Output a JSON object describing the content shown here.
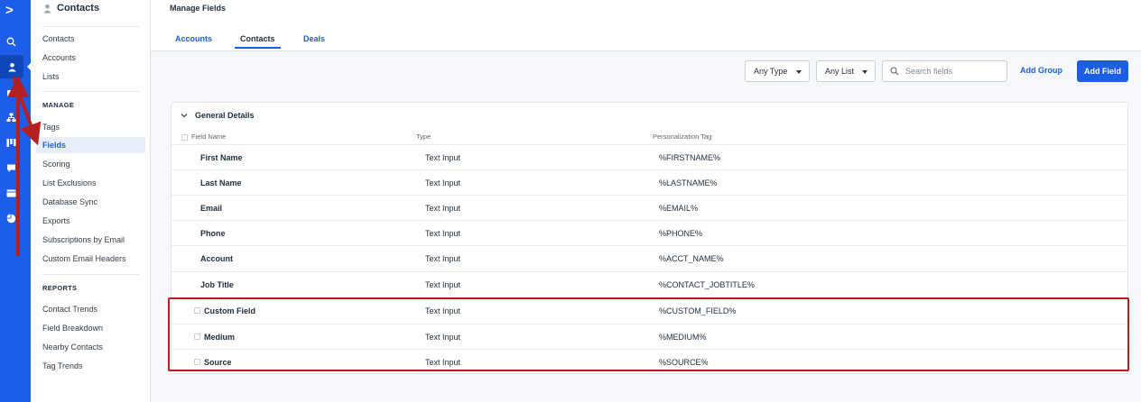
{
  "sidebar": {
    "title": "Contacts",
    "items": [
      {
        "label": "Contacts"
      },
      {
        "label": "Accounts"
      },
      {
        "label": "Lists"
      }
    ],
    "manage_heading": "MANAGE",
    "manage_items": [
      {
        "label": "Tags"
      },
      {
        "label": "Fields"
      },
      {
        "label": "Scoring"
      },
      {
        "label": "List Exclusions"
      },
      {
        "label": "Database Sync"
      },
      {
        "label": "Exports"
      },
      {
        "label": "Subscriptions by Email"
      },
      {
        "label": "Custom Email Headers"
      }
    ],
    "reports_heading": "REPORTS",
    "report_items": [
      {
        "label": "Contact Trends"
      },
      {
        "label": "Field Breakdown"
      },
      {
        "label": "Nearby Contacts"
      },
      {
        "label": "Tag Trends"
      }
    ]
  },
  "header": {
    "title": "Manage Fields",
    "tabs": [
      {
        "label": "Accounts"
      },
      {
        "label": "Contacts"
      },
      {
        "label": "Deals"
      }
    ]
  },
  "toolbar": {
    "type_filter": "Any Type",
    "list_filter": "Any List",
    "search_placeholder": "Search fields",
    "add_group": "Add Group",
    "add_field": "Add Field"
  },
  "table": {
    "group_name": "General Details",
    "columns": {
      "name": "Field Name",
      "type": "Type",
      "tag": "Personalization Tag"
    },
    "rows": [
      {
        "name": "First Name",
        "type": "Text Input",
        "tag": "%FIRSTNAME%"
      },
      {
        "name": "Last Name",
        "type": "Text Input",
        "tag": "%LASTNAME%"
      },
      {
        "name": "Email",
        "type": "Text Input",
        "tag": "%EMAIL%"
      },
      {
        "name": "Phone",
        "type": "Text Input",
        "tag": "%PHONE%"
      },
      {
        "name": "Account",
        "type": "Text Input",
        "tag": "%ACCT_NAME%"
      },
      {
        "name": "Job Title",
        "type": "Text Input",
        "tag": "%CONTACT_JOBTITLE%"
      },
      {
        "name": "Custom Field",
        "type": "Text Input",
        "tag": "%CUSTOM_FIELD%"
      },
      {
        "name": "Medium",
        "type": "Text Input",
        "tag": "%MEDIUM%"
      },
      {
        "name": "Source",
        "type": "Text Input",
        "tag": "%SOURCE%"
      }
    ]
  },
  "icons": {
    "rail": [
      "logo-icon",
      "search-icon",
      "contacts-icon",
      "campaigns-icon",
      "automations-icon",
      "deals-icon",
      "conversations-icon",
      "website-icon",
      "reports-icon"
    ],
    "annotation_color": "#b3201f",
    "brand_color": "#1c5ee8"
  }
}
